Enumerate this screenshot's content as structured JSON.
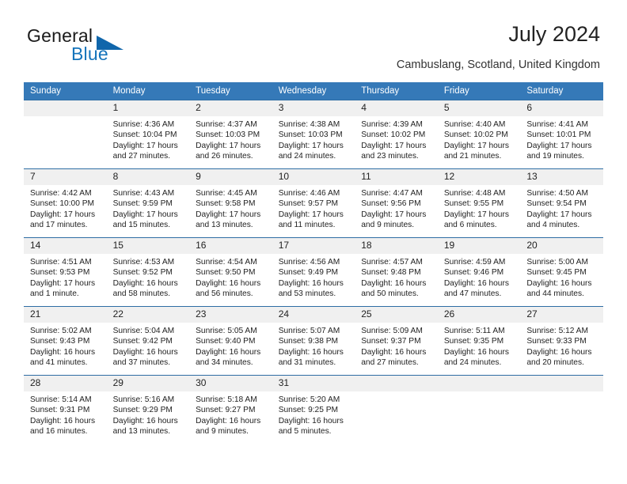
{
  "brand": {
    "name_part1": "General",
    "name_part2": "Blue"
  },
  "header": {
    "title": "July 2024",
    "subtitle": "Cambuslang, Scotland, United Kingdom"
  },
  "colors": {
    "header_blue": "#3579b8",
    "border_blue": "#2e6da4",
    "daynum_bg": "#f0f0f0",
    "brand_blue": "#1574bb"
  },
  "weekdays": [
    "Sunday",
    "Monday",
    "Tuesday",
    "Wednesday",
    "Thursday",
    "Friday",
    "Saturday"
  ],
  "weeks": [
    [
      {
        "day": "",
        "sunrise": "",
        "sunset": "",
        "daylight": ""
      },
      {
        "day": "1",
        "sunrise": "Sunrise: 4:36 AM",
        "sunset": "Sunset: 10:04 PM",
        "daylight": "Daylight: 17 hours and 27 minutes."
      },
      {
        "day": "2",
        "sunrise": "Sunrise: 4:37 AM",
        "sunset": "Sunset: 10:03 PM",
        "daylight": "Daylight: 17 hours and 26 minutes."
      },
      {
        "day": "3",
        "sunrise": "Sunrise: 4:38 AM",
        "sunset": "Sunset: 10:03 PM",
        "daylight": "Daylight: 17 hours and 24 minutes."
      },
      {
        "day": "4",
        "sunrise": "Sunrise: 4:39 AM",
        "sunset": "Sunset: 10:02 PM",
        "daylight": "Daylight: 17 hours and 23 minutes."
      },
      {
        "day": "5",
        "sunrise": "Sunrise: 4:40 AM",
        "sunset": "Sunset: 10:02 PM",
        "daylight": "Daylight: 17 hours and 21 minutes."
      },
      {
        "day": "6",
        "sunrise": "Sunrise: 4:41 AM",
        "sunset": "Sunset: 10:01 PM",
        "daylight": "Daylight: 17 hours and 19 minutes."
      }
    ],
    [
      {
        "day": "7",
        "sunrise": "Sunrise: 4:42 AM",
        "sunset": "Sunset: 10:00 PM",
        "daylight": "Daylight: 17 hours and 17 minutes."
      },
      {
        "day": "8",
        "sunrise": "Sunrise: 4:43 AM",
        "sunset": "Sunset: 9:59 PM",
        "daylight": "Daylight: 17 hours and 15 minutes."
      },
      {
        "day": "9",
        "sunrise": "Sunrise: 4:45 AM",
        "sunset": "Sunset: 9:58 PM",
        "daylight": "Daylight: 17 hours and 13 minutes."
      },
      {
        "day": "10",
        "sunrise": "Sunrise: 4:46 AM",
        "sunset": "Sunset: 9:57 PM",
        "daylight": "Daylight: 17 hours and 11 minutes."
      },
      {
        "day": "11",
        "sunrise": "Sunrise: 4:47 AM",
        "sunset": "Sunset: 9:56 PM",
        "daylight": "Daylight: 17 hours and 9 minutes."
      },
      {
        "day": "12",
        "sunrise": "Sunrise: 4:48 AM",
        "sunset": "Sunset: 9:55 PM",
        "daylight": "Daylight: 17 hours and 6 minutes."
      },
      {
        "day": "13",
        "sunrise": "Sunrise: 4:50 AM",
        "sunset": "Sunset: 9:54 PM",
        "daylight": "Daylight: 17 hours and 4 minutes."
      }
    ],
    [
      {
        "day": "14",
        "sunrise": "Sunrise: 4:51 AM",
        "sunset": "Sunset: 9:53 PM",
        "daylight": "Daylight: 17 hours and 1 minute."
      },
      {
        "day": "15",
        "sunrise": "Sunrise: 4:53 AM",
        "sunset": "Sunset: 9:52 PM",
        "daylight": "Daylight: 16 hours and 58 minutes."
      },
      {
        "day": "16",
        "sunrise": "Sunrise: 4:54 AM",
        "sunset": "Sunset: 9:50 PM",
        "daylight": "Daylight: 16 hours and 56 minutes."
      },
      {
        "day": "17",
        "sunrise": "Sunrise: 4:56 AM",
        "sunset": "Sunset: 9:49 PM",
        "daylight": "Daylight: 16 hours and 53 minutes."
      },
      {
        "day": "18",
        "sunrise": "Sunrise: 4:57 AM",
        "sunset": "Sunset: 9:48 PM",
        "daylight": "Daylight: 16 hours and 50 minutes."
      },
      {
        "day": "19",
        "sunrise": "Sunrise: 4:59 AM",
        "sunset": "Sunset: 9:46 PM",
        "daylight": "Daylight: 16 hours and 47 minutes."
      },
      {
        "day": "20",
        "sunrise": "Sunrise: 5:00 AM",
        "sunset": "Sunset: 9:45 PM",
        "daylight": "Daylight: 16 hours and 44 minutes."
      }
    ],
    [
      {
        "day": "21",
        "sunrise": "Sunrise: 5:02 AM",
        "sunset": "Sunset: 9:43 PM",
        "daylight": "Daylight: 16 hours and 41 minutes."
      },
      {
        "day": "22",
        "sunrise": "Sunrise: 5:04 AM",
        "sunset": "Sunset: 9:42 PM",
        "daylight": "Daylight: 16 hours and 37 minutes."
      },
      {
        "day": "23",
        "sunrise": "Sunrise: 5:05 AM",
        "sunset": "Sunset: 9:40 PM",
        "daylight": "Daylight: 16 hours and 34 minutes."
      },
      {
        "day": "24",
        "sunrise": "Sunrise: 5:07 AM",
        "sunset": "Sunset: 9:38 PM",
        "daylight": "Daylight: 16 hours and 31 minutes."
      },
      {
        "day": "25",
        "sunrise": "Sunrise: 5:09 AM",
        "sunset": "Sunset: 9:37 PM",
        "daylight": "Daylight: 16 hours and 27 minutes."
      },
      {
        "day": "26",
        "sunrise": "Sunrise: 5:11 AM",
        "sunset": "Sunset: 9:35 PM",
        "daylight": "Daylight: 16 hours and 24 minutes."
      },
      {
        "day": "27",
        "sunrise": "Sunrise: 5:12 AM",
        "sunset": "Sunset: 9:33 PM",
        "daylight": "Daylight: 16 hours and 20 minutes."
      }
    ],
    [
      {
        "day": "28",
        "sunrise": "Sunrise: 5:14 AM",
        "sunset": "Sunset: 9:31 PM",
        "daylight": "Daylight: 16 hours and 16 minutes."
      },
      {
        "day": "29",
        "sunrise": "Sunrise: 5:16 AM",
        "sunset": "Sunset: 9:29 PM",
        "daylight": "Daylight: 16 hours and 13 minutes."
      },
      {
        "day": "30",
        "sunrise": "Sunrise: 5:18 AM",
        "sunset": "Sunset: 9:27 PM",
        "daylight": "Daylight: 16 hours and 9 minutes."
      },
      {
        "day": "31",
        "sunrise": "Sunrise: 5:20 AM",
        "sunset": "Sunset: 9:25 PM",
        "daylight": "Daylight: 16 hours and 5 minutes."
      },
      {
        "day": "",
        "sunrise": "",
        "sunset": "",
        "daylight": ""
      },
      {
        "day": "",
        "sunrise": "",
        "sunset": "",
        "daylight": ""
      },
      {
        "day": "",
        "sunrise": "",
        "sunset": "",
        "daylight": ""
      }
    ]
  ]
}
